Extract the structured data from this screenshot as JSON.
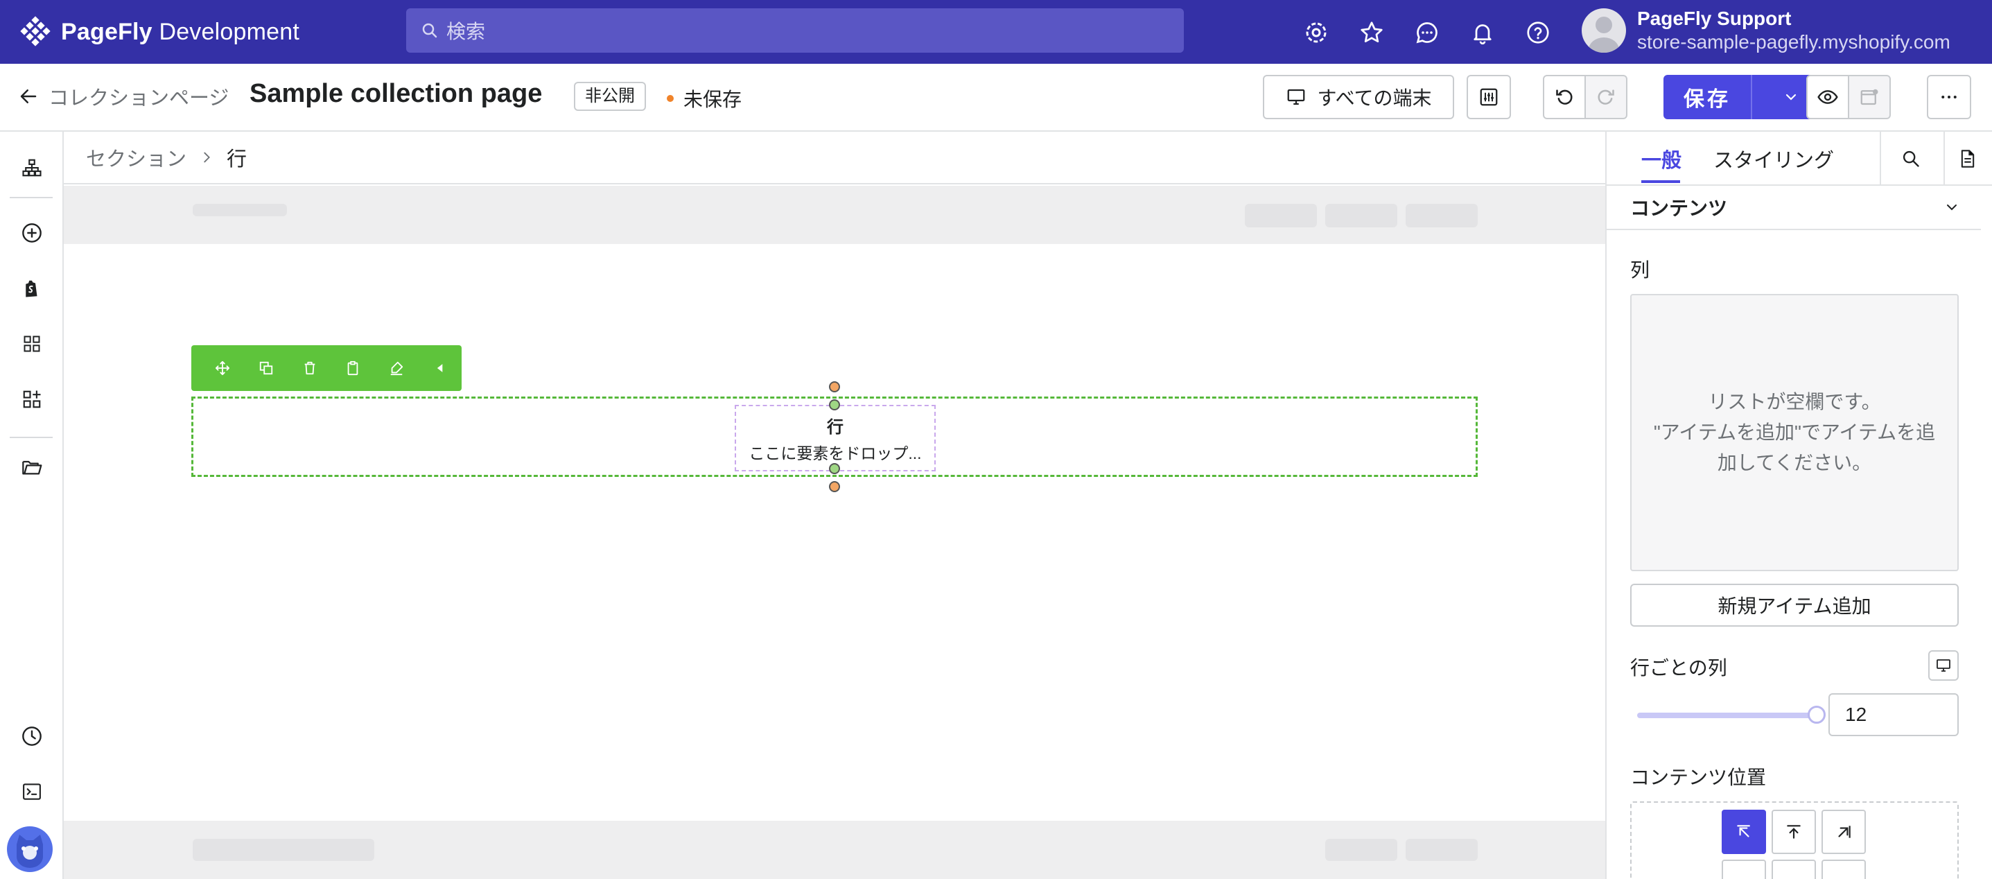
{
  "topbar": {
    "brand_bold": "PageFly",
    "brand_rest": " Development",
    "search_placeholder": "検索",
    "icons": [
      "settings-icon",
      "star-icon",
      "chat-icon",
      "bell-icon",
      "help-icon"
    ],
    "user_name": "PageFly Support",
    "user_store": "store-sample-pagefly.myshopify.com"
  },
  "header": {
    "back_label": "コレクションページ",
    "page_title": "Sample collection page",
    "status_badge": "非公開",
    "unsaved_label": "未保存",
    "device_label": "すべての端末",
    "save_label": "保存"
  },
  "leftbar": {
    "icons": [
      "sitemap-icon",
      "add-circle-icon",
      "shopify-icon",
      "grid-icon",
      "add-widget-icon",
      "folder-icon",
      "history-icon",
      "terminal-icon"
    ]
  },
  "canvas": {
    "breadcrumb": [
      "セクション",
      "行"
    ],
    "row_label": "行",
    "drop_text": "ここに要素をドロップ..."
  },
  "panel": {
    "tab_general": "一般",
    "tab_styling": "スタイリング",
    "section_title": "コンテンツ",
    "columns_label": "列",
    "empty_line1": "リストが空欄です。",
    "empty_line2": "\"アイテムを追加\"でアイテムを追加してください。",
    "add_item": "新規アイテム追加",
    "cols_per_row_label": "行ごとの列",
    "cols_per_row_value": "12",
    "cols_per_row_slider_fraction": 1.0,
    "content_position_label": "コンテンツ位置"
  },
  "colors": {
    "brand": "#3430a6",
    "accent": "#4a47e0",
    "toolbar_green": "#5ec43b"
  }
}
